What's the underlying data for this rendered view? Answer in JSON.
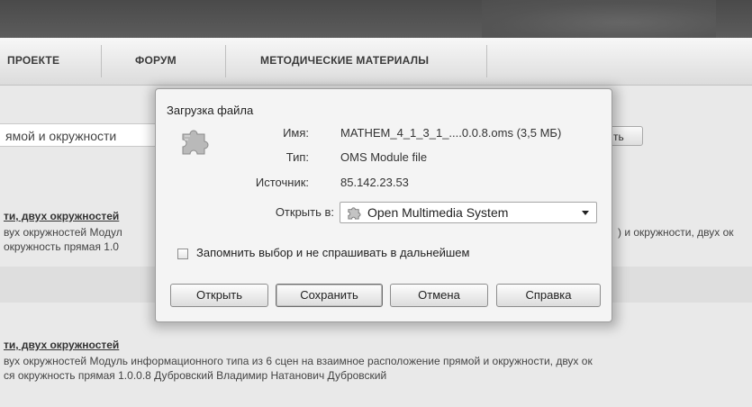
{
  "nav": {
    "items": [
      "ПРОЕКТЕ",
      "ФОРУМ",
      "МЕТОДИЧЕСКИЕ МАТЕРИАЛЫ"
    ]
  },
  "page": {
    "search_value": "ямой и окружности",
    "search_button_label": "ть",
    "results": [
      {
        "title": "ти, двух окружностей",
        "line1": "вух окружностей Модул",
        "line1_right": ") и окружности, двух ок",
        "line2": " окружность прямая 1.0"
      },
      {
        "title": "ти, двух окружностей",
        "line1": "вух окружностей Модуль информационного типа из 6 сцен на взаимное расположение прямой и окружности, двух ок",
        "line2": "ся окружность прямая 1.0.0.8 Дубровский Владимир Натанович Дубровский"
      }
    ]
  },
  "dialog": {
    "title": "Загрузка файла",
    "name_label": "Имя:",
    "name_value": "MATHEM_4_1_3_1_....0.0.8.oms (3,5 МБ)",
    "type_label": "Тип:",
    "type_value": "OMS Module file",
    "source_label": "Источник:",
    "source_value": "85.142.23.53",
    "open_with_label": "Открыть в:",
    "open_with_value": "Open Multimedia System",
    "remember_label": "Запомнить выбор и не спрашивать в дальнейшем",
    "remember_checked": false,
    "buttons": {
      "open": "Открыть",
      "save": "Сохранить",
      "cancel": "Отмена",
      "help": "Справка"
    },
    "icon": "puzzle-plugin-icon"
  }
}
